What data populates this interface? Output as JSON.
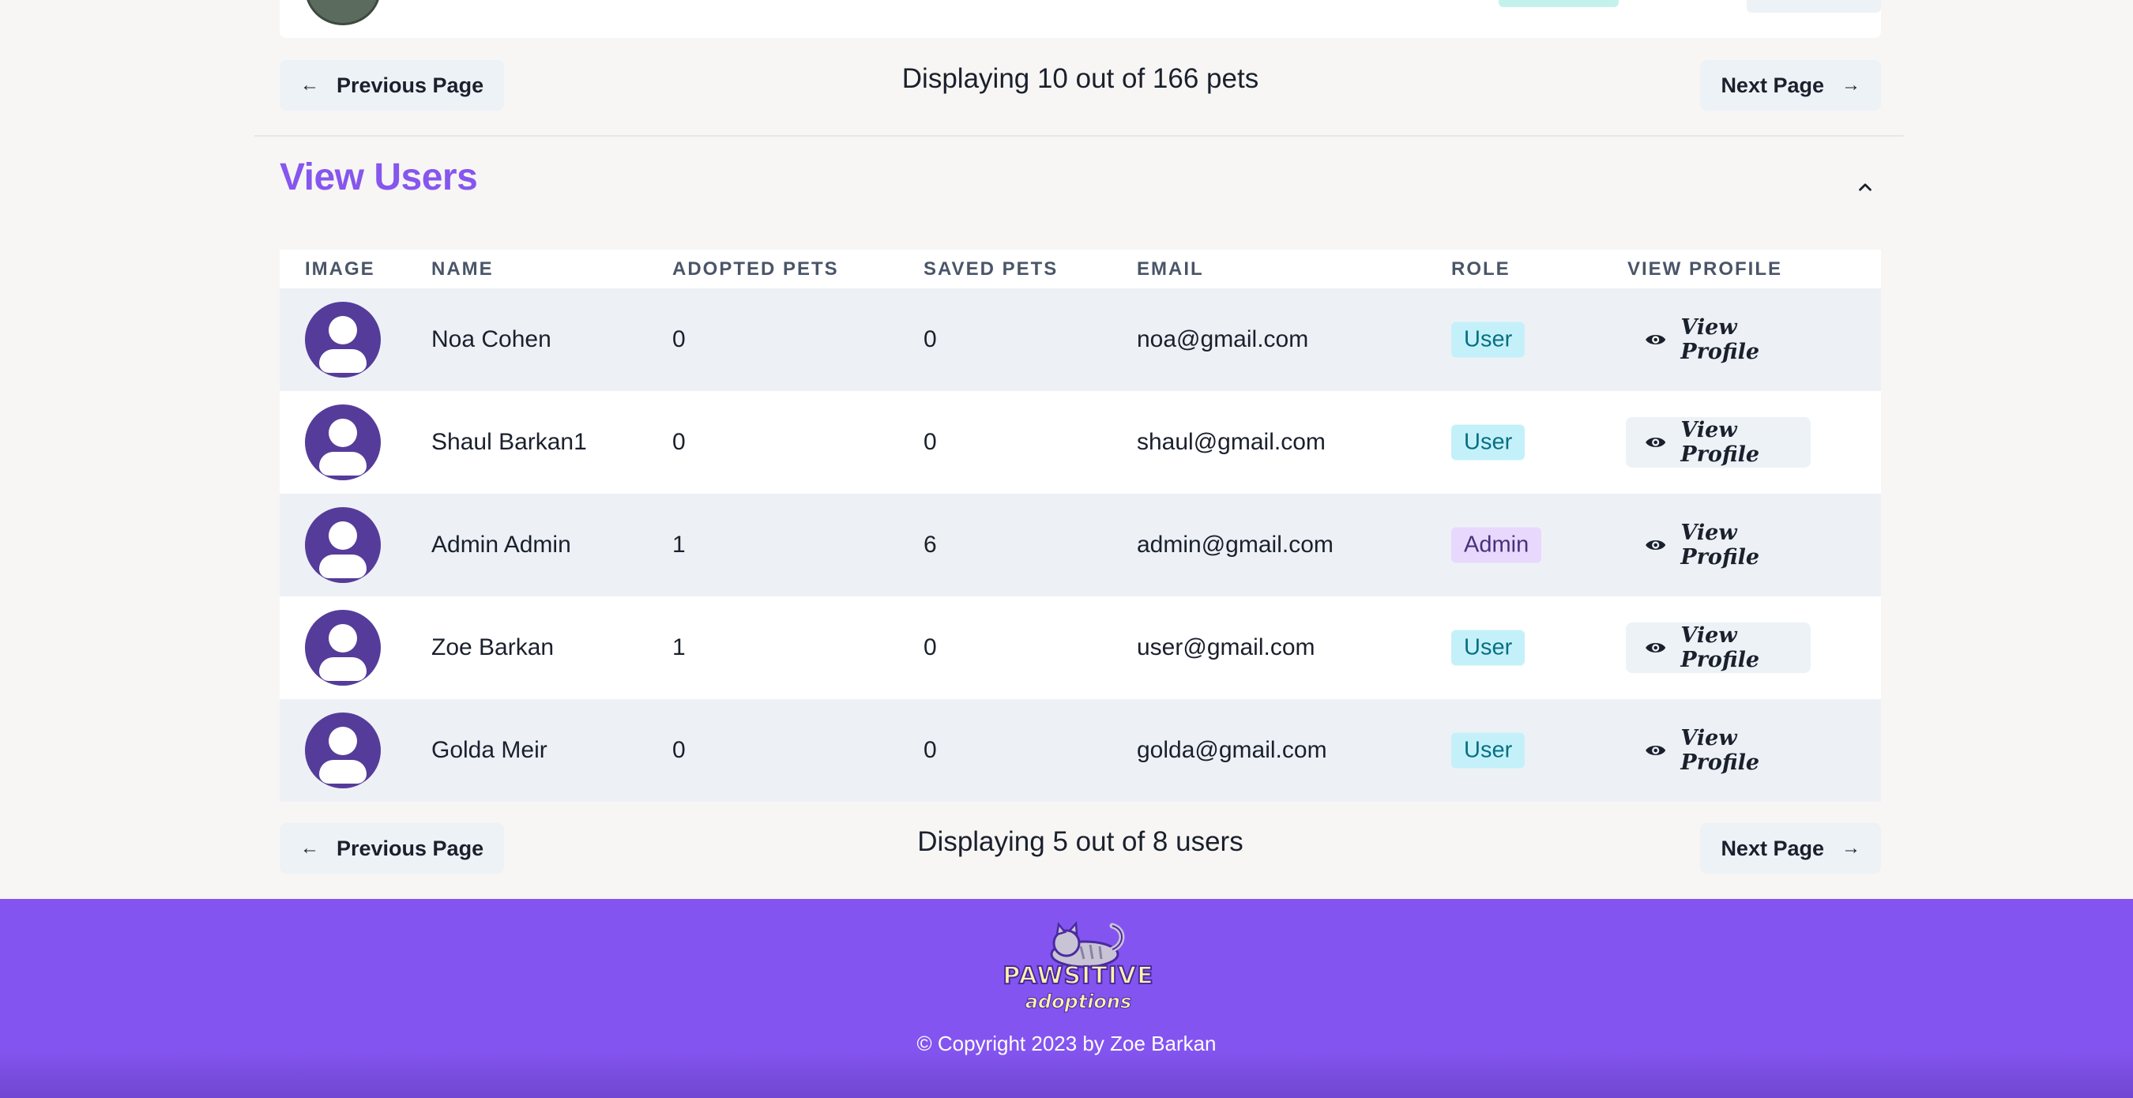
{
  "pets_pagination": {
    "prev_label": "Previous Page",
    "next_label": "Next Page",
    "status": "Displaying 10 out of 166 pets"
  },
  "users_section": {
    "title": "View Users",
    "collapse_icon": "chevron-up-icon",
    "columns": [
      "IMAGE",
      "NAME",
      "ADOPTED PETS",
      "SAVED PETS",
      "EMAIL",
      "ROLE",
      "VIEW PROFILE"
    ],
    "rows": [
      {
        "name": "Noa Cohen",
        "adopted": "0",
        "saved": "0",
        "email": "noa@gmail.com",
        "role": "User",
        "action": "View Profile"
      },
      {
        "name": "Shaul Barkan1",
        "adopted": "0",
        "saved": "0",
        "email": "shaul@gmail.com",
        "role": "User",
        "action": "View Profile"
      },
      {
        "name": "Admin Admin",
        "adopted": "1",
        "saved": "6",
        "email": "admin@gmail.com",
        "role": "Admin",
        "action": "View Profile"
      },
      {
        "name": "Zoe Barkan",
        "adopted": "1",
        "saved": "0",
        "email": "user@gmail.com",
        "role": "User",
        "action": "View Profile"
      },
      {
        "name": "Golda Meir",
        "adopted": "0",
        "saved": "0",
        "email": "golda@gmail.com",
        "role": "User",
        "action": "View Profile"
      }
    ]
  },
  "users_pagination": {
    "prev_label": "Previous Page",
    "next_label": "Next Page",
    "status": "Displaying 5 out of 8 users"
  },
  "footer": {
    "logo_line1": "PAWSITIVE",
    "logo_line2": "adoptions",
    "copyright": "© Copyright 2023 by Zoe Barkan"
  },
  "colors": {
    "accent": "#8656ee",
    "footer_bg": "#8454f0",
    "avatar_bg": "#553c9a",
    "user_badge_bg": "#c4f1f9",
    "admin_badge_bg": "#e9d8fd"
  }
}
